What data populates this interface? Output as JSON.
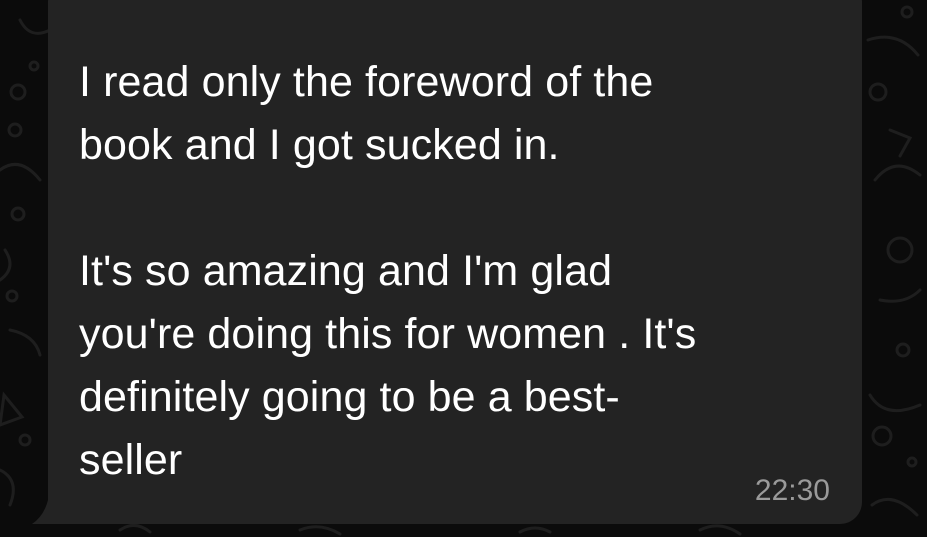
{
  "chat": {
    "theme": "dark",
    "wallpaper": "doodle-pattern",
    "colors": {
      "background": "#0b0b0b",
      "bubble": "#232323",
      "text": "#ffffff",
      "timestamp": "#9a9a9a"
    }
  },
  "message": {
    "direction": "incoming",
    "text": "I read only the foreword of the\nbook and I got sucked in.\n\nIt's so amazing and I'm glad\nyou're doing this for women . It's\ndefinitely going to be a best-\nseller",
    "time": "22:30"
  }
}
